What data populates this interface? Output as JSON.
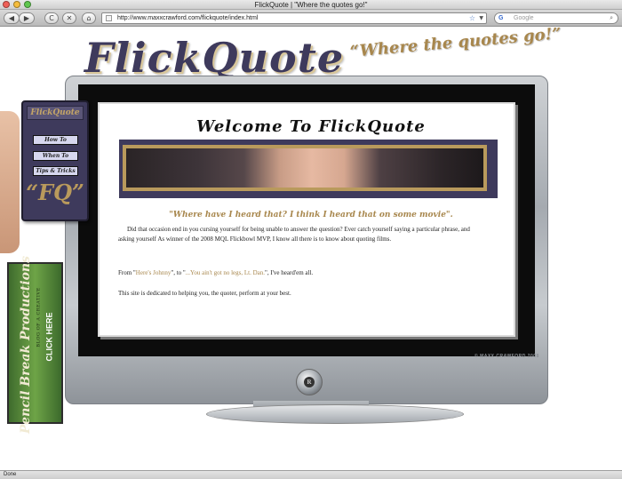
{
  "window": {
    "title": "FlickQuote | \"Where the quotes go!\""
  },
  "toolbar": {
    "back_glyph": "◀",
    "forward_glyph": "▶",
    "reload_glyph": "C",
    "stop_glyph": "✕",
    "home_glyph": "⌂",
    "url": "http://www.maxxcrawford.com/flickquote/index.html",
    "bookmark_glyph": "☆",
    "search_engine_label": "G",
    "search_placeholder": "Google"
  },
  "status": {
    "text": "Done"
  },
  "header": {
    "logo": "FlickQuote",
    "tagline": "“Where the quotes go!”"
  },
  "nav_phone": {
    "title": "FlickQuote",
    "items": [
      {
        "label": "How To"
      },
      {
        "label": "When To"
      },
      {
        "label": "Tips & Tricks"
      }
    ],
    "badge": "“FQ”"
  },
  "promo": {
    "brand": "Pencil Break Productions",
    "subtitle": "BLOG OF A CREATIVE",
    "cta": "CLICK HERE"
  },
  "tv": {
    "credit": "© MAXX CRAWFORD 2008",
    "power_logo": "R"
  },
  "main": {
    "heading": "Welcome To FlickQuote",
    "quote": "\"Where have I heard that? I think I heard that on some movie\".",
    "p1": "Did that occasion end in you cursing yourself for being unable to answer the question? Ever catch yourself saying a particular phrase, and asking yourself As winner of the 2008 MQL Flickbowl MVP, I know all there is to know about quoting films.",
    "p2_prefix": "From \"",
    "p2_link1": "Here's Johnny",
    "p2_mid": "\", to \"",
    "p2_link2": "...You ain't got no legs, Lt. Dan.",
    "p2_suffix": "\", I've heard'em all.",
    "p3": "This site is dedicated to helping you, the quoter, perform at your best."
  }
}
